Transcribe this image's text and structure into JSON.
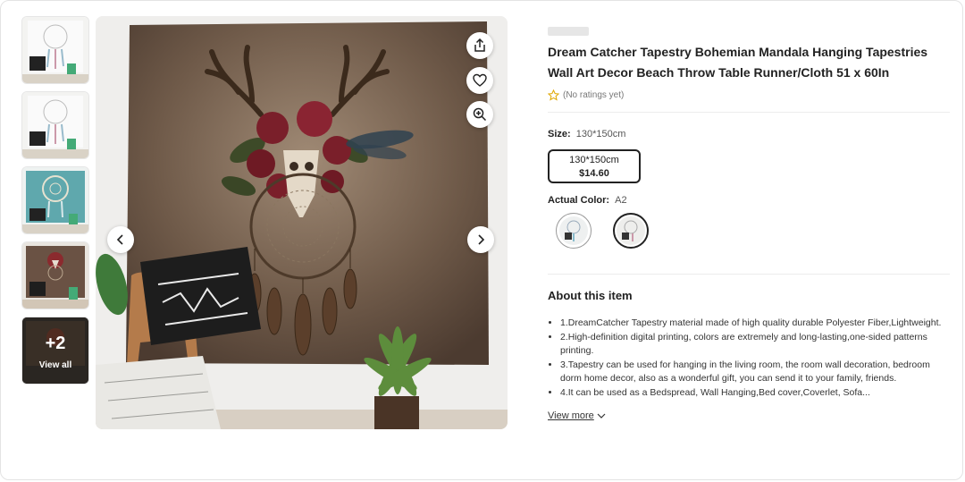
{
  "product": {
    "title": "Dream Catcher Tapestry Bohemian Mandala Hanging Tapestries Wall Art Decor Beach Throw Table Runner/Cloth 51 x 60In",
    "rating_text": "(No ratings yet)"
  },
  "gallery": {
    "more_count": "+2",
    "view_all_label": "View all",
    "thumbnails": [
      "white dreamcatcher tapestry",
      "white dreamcatcher tapestry",
      "teal dreamcatcher tapestry",
      "brown deer skull tapestry"
    ]
  },
  "size": {
    "label": "Size:",
    "selected": "130*150cm",
    "option_label": "130*150cm",
    "option_price": "$14.60"
  },
  "color": {
    "label": "Actual Color:",
    "selected": "A2"
  },
  "about": {
    "heading": "About this item",
    "bullets": [
      "1.DreamCatcher Tapestry material made of high quality durable Polyester Fiber,Lightweight.",
      "2.High-definition digital printing, colors are extremely and long-lasting,one-sided patterns printing.",
      "3.Tapestry can be used for hanging in the living room, the room wall decoration, bedroom dorm home decor, also as a wonderful gift, you can send it to your family, friends.",
      "4.It can be used as a Bedspread, Wall Hanging,Bed cover,Coverlet, Sofa..."
    ],
    "view_more": "View more"
  },
  "icons": {
    "share": "share-icon",
    "favorite": "heart-icon",
    "zoom": "zoom-in-icon",
    "prev": "chevron-left-icon",
    "next": "chevron-right-icon",
    "star": "star-outline-icon"
  },
  "colors": {
    "star": "#e0a800",
    "text": "#222222"
  }
}
